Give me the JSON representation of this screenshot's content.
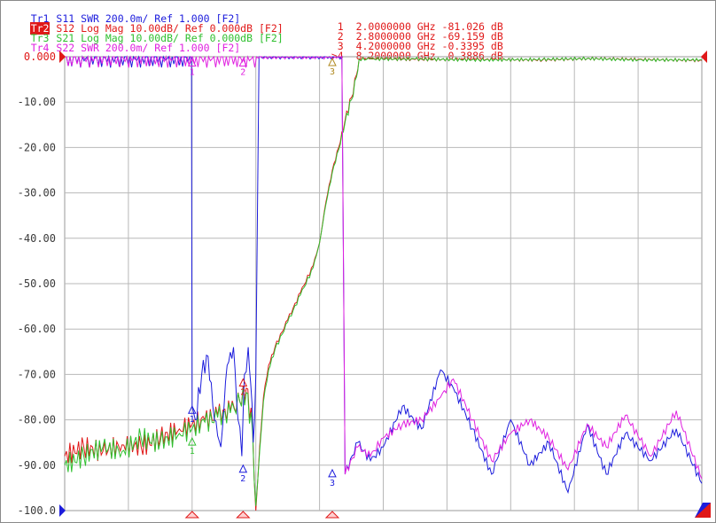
{
  "colors": {
    "tr1": "#1c1cdc",
    "tr2": "#e01818",
    "tr3": "#30c030",
    "tr4": "#e020e0",
    "grid": "#b8b8b8",
    "axis_text": "#3a3a3a",
    "active_bg": "#e01818"
  },
  "traces": [
    {
      "name": "Tr1",
      "param": "S11",
      "format": "SWR",
      "scale": "200.0m/",
      "ref": "Ref 1.000",
      "tag": "[F2]",
      "color": "#1c1cdc",
      "active": false
    },
    {
      "name": "Tr2",
      "param": "S12",
      "format": "Log Mag",
      "scale": "10.00dB/",
      "ref": "Ref 0.000dB",
      "tag": "[F2]",
      "color": "#e01818",
      "active": true
    },
    {
      "name": "Tr3",
      "param": "S21",
      "format": "Log Mag",
      "scale": "10.00dB/",
      "ref": "Ref 0.000dB",
      "tag": "[F2]",
      "color": "#30c030",
      "active": false
    },
    {
      "name": "Tr4",
      "param": "S22",
      "format": "SWR",
      "scale": "200.0m/",
      "ref": "Ref 1.000",
      "tag": "[F2]",
      "color": "#e020e0",
      "active": false
    }
  ],
  "markers": [
    {
      "label": "1",
      "freq": "2.0000000 GHz",
      "value": "-81.026 dB",
      "active": false
    },
    {
      "label": "2",
      "freq": "2.8000000 GHz",
      "value": "-69.159 dB",
      "active": false
    },
    {
      "label": "3",
      "freq": "4.2000000 GHz",
      "value": "-0.3395 dB",
      "active": false
    },
    {
      "label": ">4",
      "freq": "8.2000000 GHz",
      "value": "-0.3886 dB",
      "active": true
    }
  ],
  "chart_data": {
    "type": "line",
    "ylim": [
      -100,
      0
    ],
    "yticks": [
      "0.000",
      "-10.00",
      "-20.00",
      "-30.00",
      "-40.00",
      "-50.00",
      "-60.00",
      "-70.00",
      "-80.00",
      "-90.00",
      "-100.0"
    ],
    "xdiv": 10,
    "grid": true,
    "series": [
      {
        "name": "S12",
        "color": "#e01818",
        "points": [
          [
            0,
            -88
          ],
          [
            0.3,
            -86
          ],
          [
            0.6,
            -87
          ],
          [
            0.9,
            -85.5
          ],
          [
            1.2,
            -86
          ],
          [
            1.5,
            -84
          ],
          [
            1.8,
            -82
          ],
          [
            2.0,
            -81
          ],
          [
            2.2,
            -80
          ],
          [
            2.4,
            -79
          ],
          [
            2.6,
            -78
          ],
          [
            2.75,
            -76
          ],
          [
            2.85,
            -73
          ],
          [
            2.95,
            -82
          ],
          [
            3.0,
            -100
          ],
          [
            3.06,
            -86
          ],
          [
            3.12,
            -75
          ],
          [
            3.2,
            -68
          ],
          [
            3.3,
            -64
          ],
          [
            3.5,
            -58
          ],
          [
            3.7,
            -52
          ],
          [
            3.9,
            -46
          ],
          [
            4.0,
            -41
          ],
          [
            4.1,
            -32
          ],
          [
            4.2,
            -25
          ],
          [
            4.3,
            -20
          ],
          [
            4.4,
            -14
          ],
          [
            4.5,
            -9
          ],
          [
            4.58,
            -4
          ],
          [
            4.62,
            -0.5
          ],
          [
            4.8,
            -0.4
          ],
          [
            5.5,
            -0.6
          ],
          [
            6.5,
            -0.6
          ],
          [
            7.5,
            -0.7
          ],
          [
            8.2,
            -0.4
          ],
          [
            9.0,
            -0.6
          ],
          [
            10,
            -0.8
          ]
        ]
      },
      {
        "name": "S21",
        "color": "#30c030",
        "points": [
          [
            0,
            -90
          ],
          [
            0.3,
            -88
          ],
          [
            0.6,
            -86
          ],
          [
            0.9,
            -87
          ],
          [
            1.2,
            -84
          ],
          [
            1.5,
            -85
          ],
          [
            1.8,
            -83
          ],
          [
            2.0,
            -82
          ],
          [
            2.2,
            -80.5
          ],
          [
            2.4,
            -79.5
          ],
          [
            2.6,
            -78.5
          ],
          [
            2.75,
            -76
          ],
          [
            2.85,
            -74
          ],
          [
            2.95,
            -83
          ],
          [
            3.0,
            -99
          ],
          [
            3.06,
            -87
          ],
          [
            3.12,
            -76
          ],
          [
            3.2,
            -69
          ],
          [
            3.3,
            -64.5
          ],
          [
            3.5,
            -58.5
          ],
          [
            3.7,
            -52.5
          ],
          [
            3.9,
            -46.5
          ],
          [
            4.0,
            -41
          ],
          [
            4.1,
            -32.5
          ],
          [
            4.2,
            -25.5
          ],
          [
            4.3,
            -20.5
          ],
          [
            4.4,
            -14.5
          ],
          [
            4.5,
            -9.5
          ],
          [
            4.58,
            -4.5
          ],
          [
            4.62,
            -0.6
          ],
          [
            4.8,
            -0.5
          ],
          [
            5.5,
            -0.5
          ],
          [
            6.5,
            -0.7
          ],
          [
            7.5,
            -0.6
          ],
          [
            8.2,
            -0.4
          ],
          [
            9.0,
            -0.7
          ],
          [
            10,
            -0.7
          ]
        ]
      },
      {
        "name": "S11",
        "color": "#1c1cdc",
        "points": [
          [
            0,
            0
          ],
          [
            1.99,
            0
          ],
          [
            2.0,
            -77
          ],
          [
            2.05,
            -80
          ],
          [
            2.15,
            -70
          ],
          [
            2.25,
            -66
          ],
          [
            2.35,
            -80
          ],
          [
            2.45,
            -86
          ],
          [
            2.55,
            -68
          ],
          [
            2.65,
            -64
          ],
          [
            2.72,
            -80
          ],
          [
            2.78,
            -88
          ],
          [
            2.82,
            -70
          ],
          [
            2.88,
            -64
          ],
          [
            2.92,
            -72
          ],
          [
            2.96,
            -85
          ],
          [
            3.0,
            -70
          ],
          [
            3.05,
            0
          ],
          [
            4.35,
            0
          ],
          [
            4.4,
            -92
          ],
          [
            4.6,
            -85
          ],
          [
            4.8,
            -89
          ],
          [
            5.0,
            -86
          ],
          [
            5.3,
            -77
          ],
          [
            5.6,
            -82
          ],
          [
            5.9,
            -69
          ],
          [
            6.1,
            -73
          ],
          [
            6.4,
            -82
          ],
          [
            6.7,
            -92
          ],
          [
            7.0,
            -80
          ],
          [
            7.3,
            -90
          ],
          [
            7.6,
            -85
          ],
          [
            7.9,
            -96
          ],
          [
            8.2,
            -81
          ],
          [
            8.5,
            -92
          ],
          [
            8.8,
            -83
          ],
          [
            9.2,
            -89
          ],
          [
            9.6,
            -82
          ],
          [
            10,
            -94
          ]
        ]
      },
      {
        "name": "S22",
        "color": "#e020e0",
        "points": [
          [
            0,
            0
          ],
          [
            4.35,
            0
          ],
          [
            4.4,
            -92
          ],
          [
            4.6,
            -86
          ],
          [
            4.8,
            -88
          ],
          [
            5.0,
            -84
          ],
          [
            5.3,
            -81
          ],
          [
            5.6,
            -80
          ],
          [
            5.9,
            -75
          ],
          [
            6.1,
            -71
          ],
          [
            6.4,
            -80
          ],
          [
            6.7,
            -89
          ],
          [
            7.0,
            -83
          ],
          [
            7.3,
            -80
          ],
          [
            7.6,
            -84
          ],
          [
            7.9,
            -91
          ],
          [
            8.2,
            -81
          ],
          [
            8.5,
            -86
          ],
          [
            8.8,
            -79
          ],
          [
            9.2,
            -88
          ],
          [
            9.6,
            -78
          ],
          [
            10,
            -93
          ]
        ]
      }
    ]
  }
}
